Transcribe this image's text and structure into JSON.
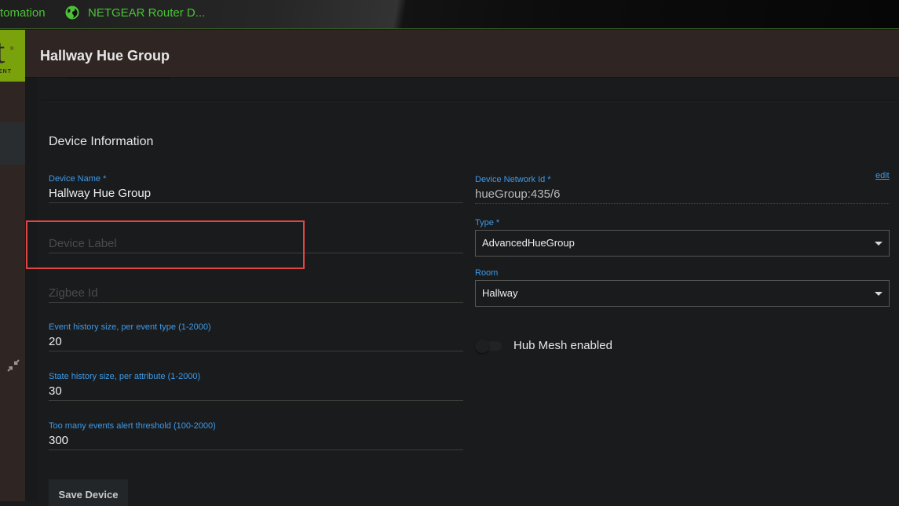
{
  "bookmarks": [
    {
      "label": "tomation",
      "icon": "none"
    },
    {
      "label": "NETGEAR Router D...",
      "icon": "globe-icon"
    }
  ],
  "sidebar": {
    "logo_letter": "t",
    "logo_mark": "®",
    "logo_sub": "ENT",
    "collapse_icon": "collapse-arrows-icon"
  },
  "header": {
    "title": "Hallway Hue Group"
  },
  "device_information": {
    "section_title": "Device Information",
    "device_name": {
      "label": "Device Name *",
      "value": "Hallway Hue Group"
    },
    "device_label": {
      "placeholder": "Device Label",
      "value": ""
    },
    "zigbee_id": {
      "placeholder": "Zigbee Id",
      "value": ""
    },
    "event_history": {
      "label": "Event history size, per event type (1-2000)",
      "value": "20"
    },
    "state_history": {
      "label": "State history size, per attribute (1-2000)",
      "value": "30"
    },
    "alert_threshold": {
      "label": "Too many events alert threshold (100-2000)",
      "value": "300"
    },
    "device_network_id": {
      "label": "Device Network Id *",
      "value": "hueGroup:435/6",
      "edit_label": "edit"
    },
    "type": {
      "label": "Type *",
      "selected": "AdvancedHueGroup"
    },
    "room": {
      "label": "Room",
      "selected": "Hallway"
    },
    "hub_mesh": {
      "label": "Hub Mesh enabled",
      "enabled": false
    },
    "save_label": "Save Device"
  },
  "colors": {
    "accent_label": "#3d9be9",
    "brand_green": "#7aa20c",
    "bookmark_text": "#4cc239",
    "highlight_box": "#e24443",
    "header_bg": "#2f2523"
  }
}
